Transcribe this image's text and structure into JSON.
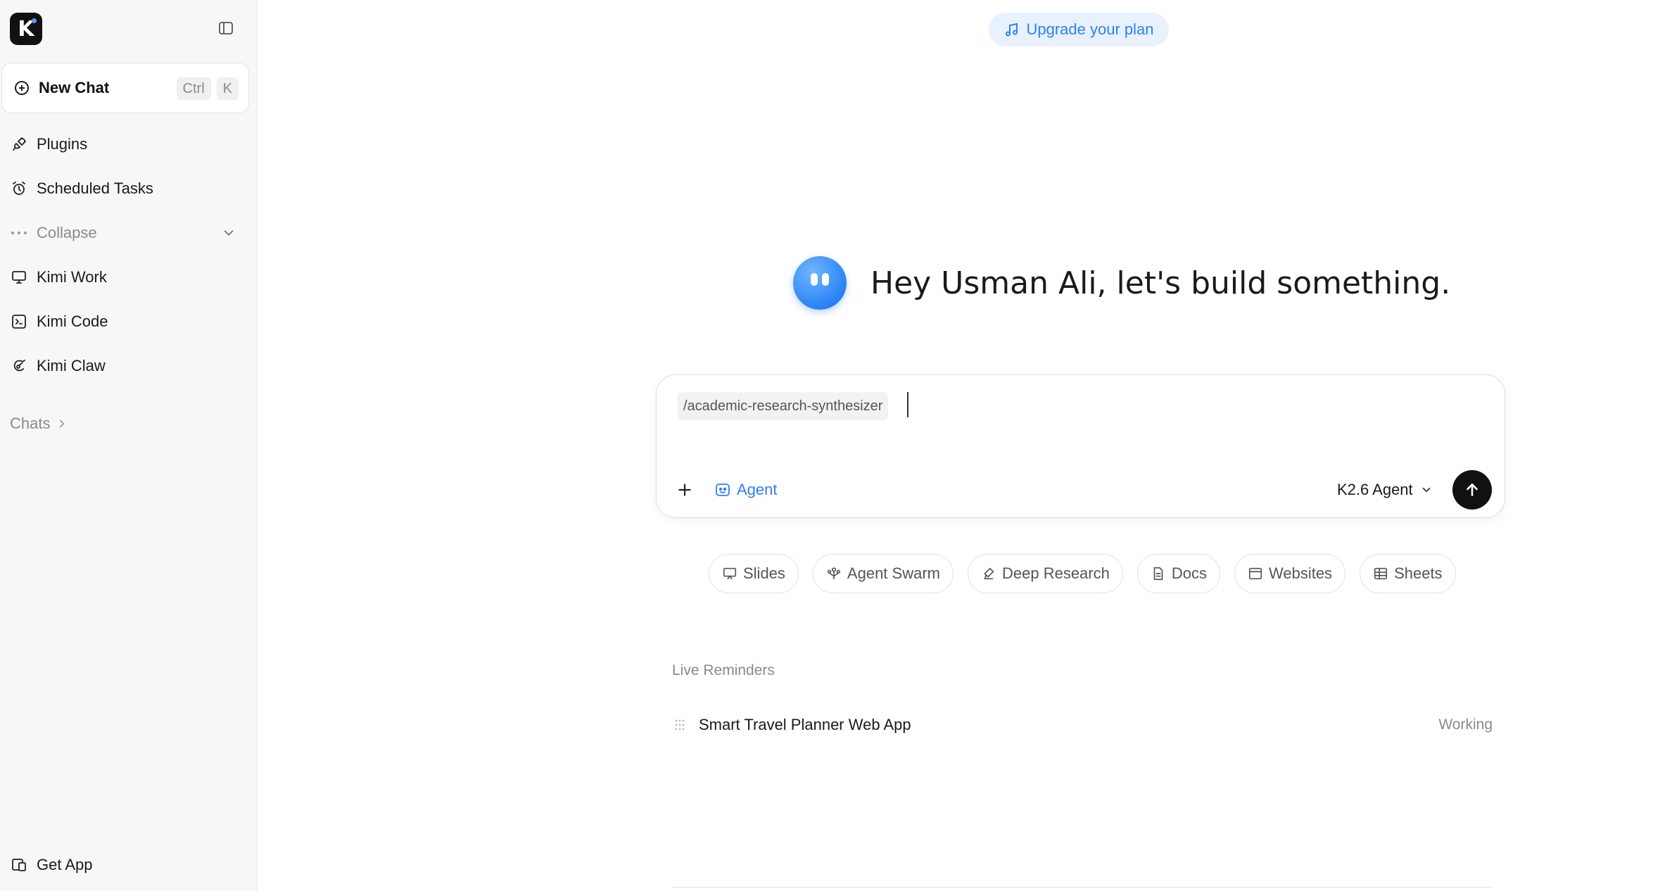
{
  "sidebar": {
    "logo_letter": "K",
    "new_chat": {
      "label": "New Chat",
      "shortcut": [
        "Ctrl",
        "K"
      ]
    },
    "items": [
      {
        "label": "Plugins",
        "icon": "plug-icon"
      },
      {
        "label": "Scheduled Tasks",
        "icon": "alarm-clock-icon"
      }
    ],
    "collapse": {
      "label": "Collapse"
    },
    "apps": [
      {
        "label": "Kimi Work",
        "icon": "monitor-icon"
      },
      {
        "label": "Kimi Code",
        "icon": "terminal-icon"
      },
      {
        "label": "Kimi Claw",
        "icon": "claw-icon"
      }
    ],
    "chats_label": "Chats",
    "get_app": {
      "label": "Get App",
      "icon": "devices-icon"
    }
  },
  "header": {
    "upgrade_label": "Upgrade your plan"
  },
  "greeting": {
    "text": "Hey Usman Ali, let's build something."
  },
  "composer": {
    "command_chip": "/academic-research-synthesizer",
    "agent_label": "Agent",
    "model_label": "K2.6 Agent"
  },
  "chips": [
    {
      "label": "Slides",
      "icon": "slides-icon"
    },
    {
      "label": "Agent Swarm",
      "icon": "swarm-icon"
    },
    {
      "label": "Deep Research",
      "icon": "research-icon"
    },
    {
      "label": "Docs",
      "icon": "doc-icon"
    },
    {
      "label": "Websites",
      "icon": "browser-icon"
    },
    {
      "label": "Sheets",
      "icon": "table-icon"
    }
  ],
  "reminders": {
    "title": "Live Reminders",
    "items": [
      {
        "title": "Smart Travel Planner Web App",
        "status": "Working"
      }
    ]
  },
  "colors": {
    "accent": "#2f7ff5",
    "upgrade_bg": "#e8f2ff",
    "sidebar_bg": "#f7f7f7",
    "send_bg": "#111111"
  }
}
